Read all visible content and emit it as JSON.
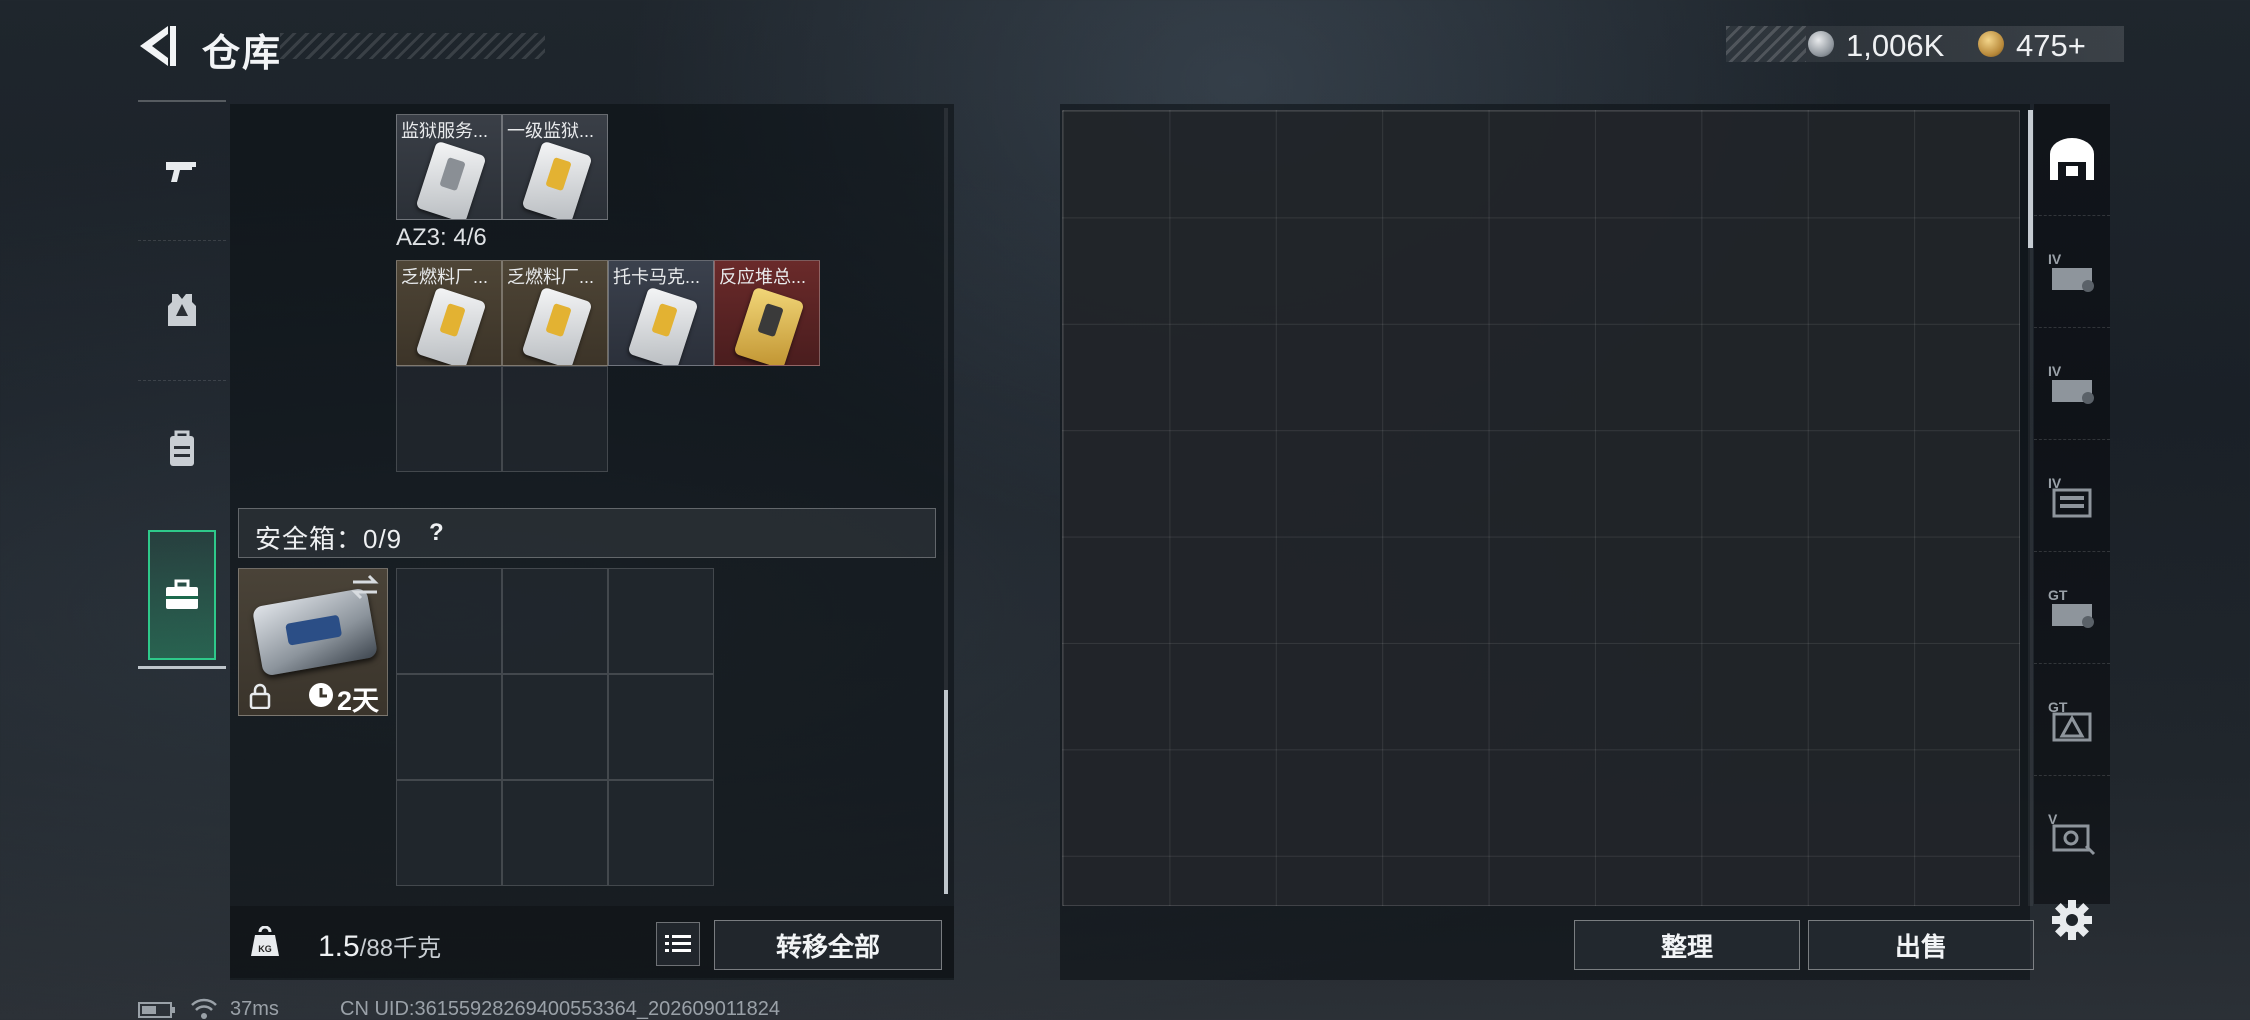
{
  "header": {
    "title": "仓库",
    "currency": {
      "silver": "1,006K",
      "gold": "475+"
    }
  },
  "sidebar": {
    "items": [
      {
        "name": "weapons",
        "icon": "gun-icon"
      },
      {
        "name": "armor",
        "icon": "vest-icon"
      },
      {
        "name": "backpack",
        "icon": "backpack-icon"
      },
      {
        "name": "case",
        "icon": "briefcase-icon",
        "active": true
      }
    ]
  },
  "left_panel": {
    "top_items": [
      {
        "label": "监狱服务...",
        "color": "grey"
      },
      {
        "label": "一级监狱...",
        "color": "grey"
      }
    ],
    "az3": {
      "label": "AZ3: 4/6",
      "items": [
        {
          "label": "乏燃料厂...",
          "color": "brown"
        },
        {
          "label": "乏燃料厂...",
          "color": "brown"
        },
        {
          "label": "托卡马克...",
          "color": "blue"
        },
        {
          "label": "反应堆总...",
          "color": "red"
        }
      ]
    },
    "safebox": {
      "label": "安全箱：0/9",
      "help": "?",
      "timer": "2天"
    },
    "weight": {
      "value": "1.5",
      "capacity": "/88千克"
    },
    "transfer_all": "转移全部"
  },
  "right_panel": {
    "sort": "整理",
    "sell": "出售"
  },
  "status": {
    "ping": "37ms",
    "uid": "CN UID:36155928269400553364_202609011824"
  }
}
